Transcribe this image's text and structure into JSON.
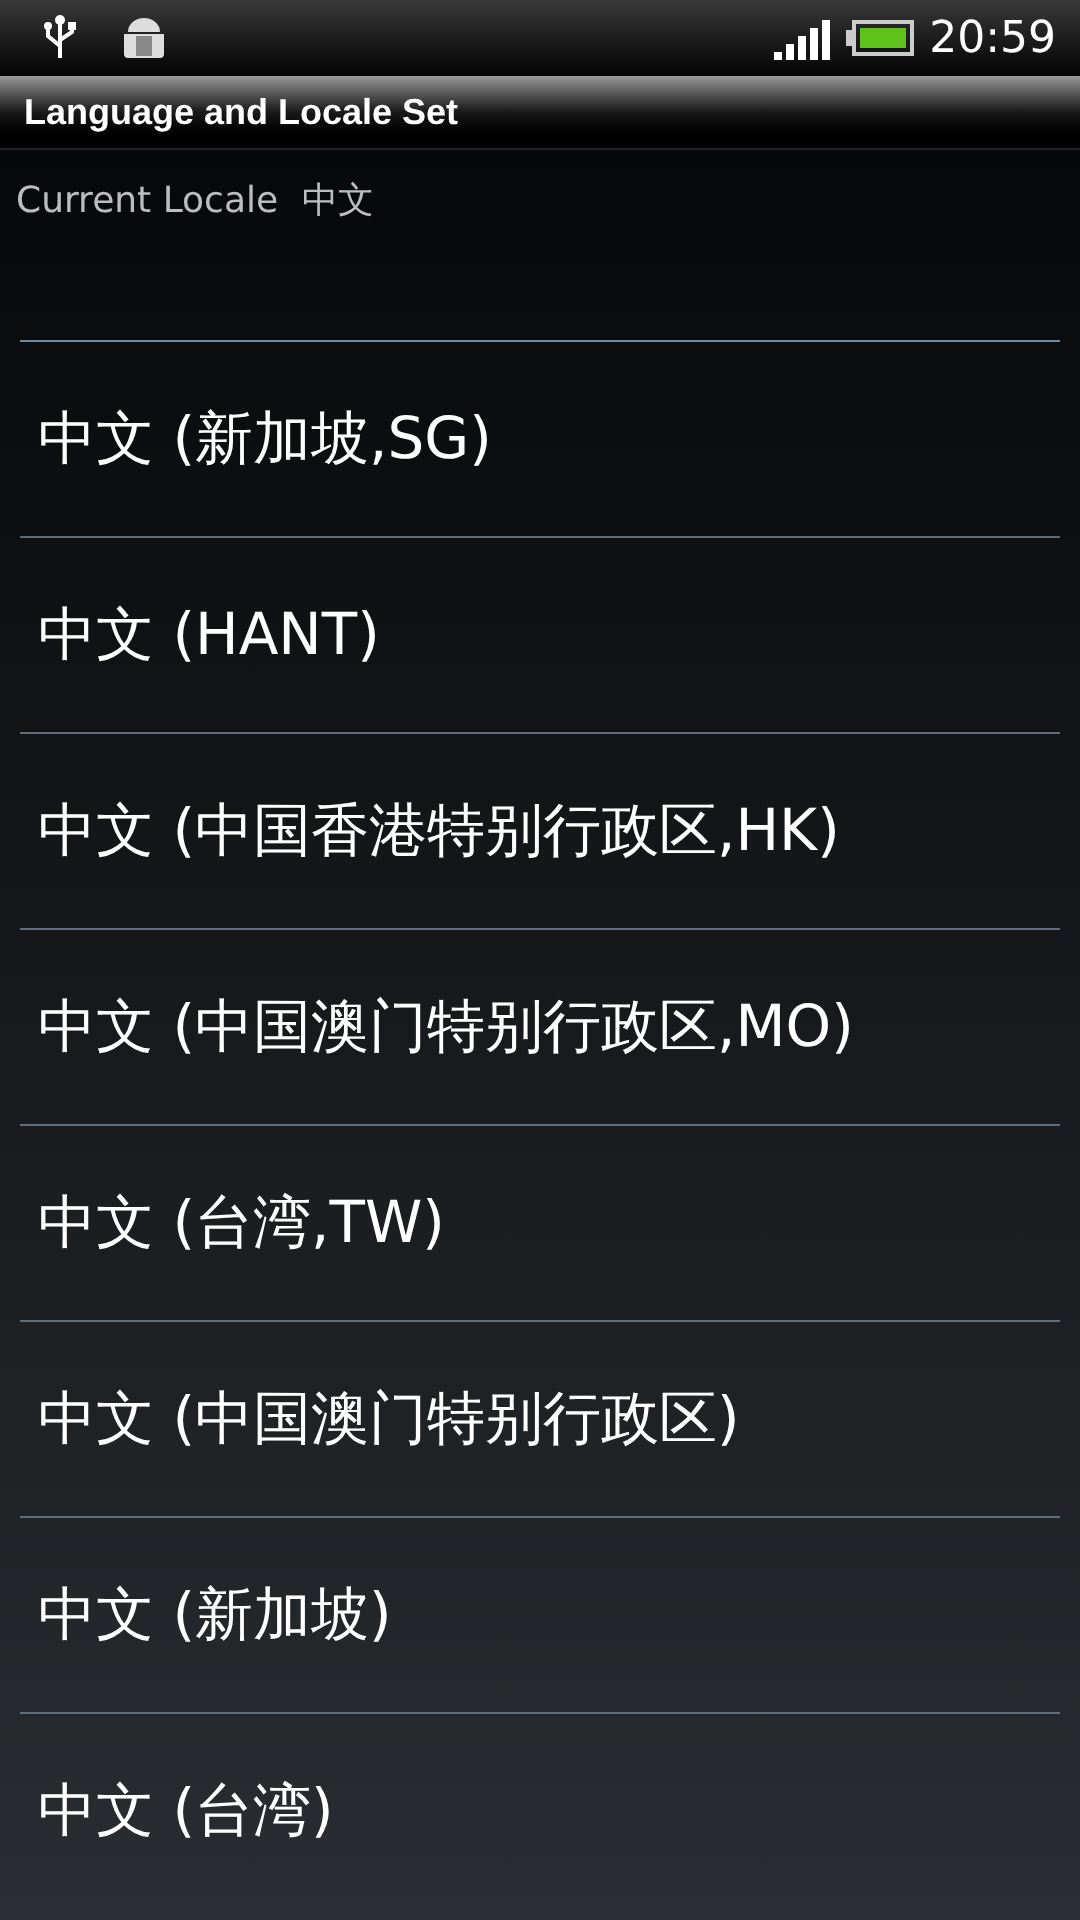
{
  "status_bar": {
    "time": "20:59"
  },
  "window": {
    "title": "Language and Locale Set"
  },
  "current_locale": {
    "label": "Current Locale",
    "value": "中文"
  },
  "locales": [
    {
      "label": "中文 (新加坡,SG)"
    },
    {
      "label": "中文 (HANT)"
    },
    {
      "label": "中文 (中国香港特别行政区,HK)"
    },
    {
      "label": "中文 (中国澳门特别行政区,MO)"
    },
    {
      "label": "中文 (台湾,TW)"
    },
    {
      "label": "中文 (中国澳门特别行政区)"
    },
    {
      "label": "中文 (新加坡)"
    },
    {
      "label": "中文 (台湾)"
    }
  ]
}
